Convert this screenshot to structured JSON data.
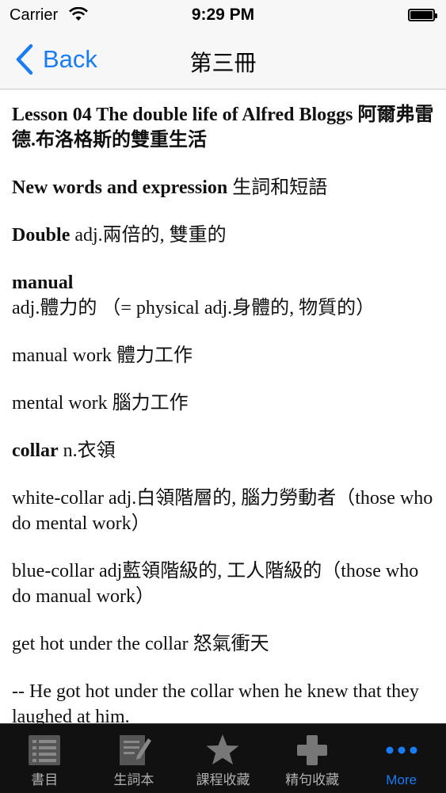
{
  "status_bar": {
    "carrier": "Carrier",
    "time": "9:29 PM"
  },
  "nav": {
    "back_label": "Back",
    "title": "第三冊"
  },
  "content": {
    "lesson_title": "Lesson 04  The double life of Alfred Bloggs 阿爾弗雷德.布洛格斯的雙重生活",
    "section_heading": "New words and expression",
    "section_heading_cn": " 生詞和短語",
    "entries": [
      {
        "word": "Double",
        "def": "  adj.兩倍的, 雙重的"
      },
      {
        "word": "manual",
        "def": "  adj.體力的 （= physical  adj.身體的, 物質的）"
      },
      {
        "word": "",
        "def": "manual work 體力工作"
      },
      {
        "word": "",
        "def": "mental work 腦力工作"
      },
      {
        "word": "collar",
        "def": "  n.衣領"
      },
      {
        "word": "",
        "def": "white-collar  adj.白領階層的, 腦力勞動者（those who do mental work）"
      },
      {
        "word": "",
        "def": "blue-collar  adj藍領階級的, 工人階級的（those who do manual work）"
      },
      {
        "word": "",
        "def": "get hot under the collar 怒氣衝天"
      },
      {
        "word": "",
        "def": "-- He got hot under the collar when he knew that they laughed at him."
      }
    ]
  },
  "tabs": [
    {
      "label": "書目",
      "icon": "list-icon"
    },
    {
      "label": "生詞本",
      "icon": "notebook-icon"
    },
    {
      "label": "課程收藏",
      "icon": "star-icon"
    },
    {
      "label": "精句收藏",
      "icon": "plus-icon"
    },
    {
      "label": "More",
      "icon": "more-icon"
    }
  ],
  "colors": {
    "accent": "#1a7cf5",
    "tabbar_bg": "#111111",
    "tab_inactive": "#b0b0b0"
  }
}
